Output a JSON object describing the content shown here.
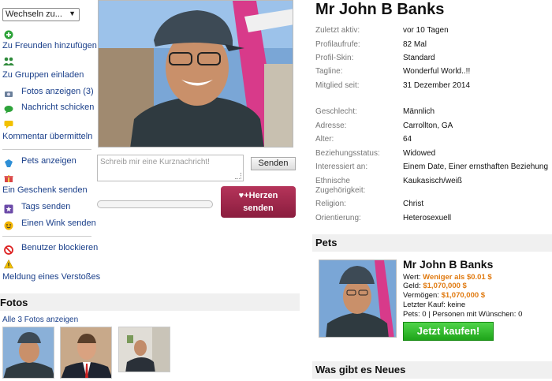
{
  "switcher": {
    "label": "Wechseln zu..."
  },
  "actions": {
    "add_friend": "Zu Freunden hinzufügen",
    "invite_groups": "Zu Gruppen einladen",
    "show_photos": "Fotos anzeigen (3)",
    "send_message": "Nachricht schicken",
    "send_comment": "Kommentar übermitteln",
    "show_pets": "Pets anzeigen",
    "send_gift": "Ein Geschenk senden",
    "send_tags": "Tags senden",
    "send_wink": "Einen Wink senden",
    "block_user": "Benutzer blockieren",
    "report": "Meldung eines Verstoßes"
  },
  "message": {
    "placeholder": "Schreib mir eine Kurznachricht!",
    "send_label": "Senden"
  },
  "hearts": {
    "label_line1": "Herzen",
    "label_line2": "senden",
    "progress": 0
  },
  "fotos": {
    "title": "Fotos",
    "all_link": "Alle 3 Fotos anzeigen"
  },
  "profile": {
    "name": "Mr John B Banks",
    "fields": [
      {
        "label": "Zuletzt aktiv:",
        "value": "vor 10 Tagen"
      },
      {
        "label": "Profilaufrufe:",
        "value": "82 Mal"
      },
      {
        "label": "Profil-Skin:",
        "value": "Standard"
      },
      {
        "label": "Tagline:",
        "value": "Wonderful World..!!"
      },
      {
        "label": "Mitglied seit:",
        "value": "31 Dezember 2014"
      },
      {
        "label": "Geschlecht:",
        "value": "Männlich"
      },
      {
        "label": "Adresse:",
        "value": "Carrollton, GA"
      },
      {
        "label": "Alter:",
        "value": "64"
      },
      {
        "label": "Beziehungsstatus:",
        "value": "Widowed"
      },
      {
        "label": "Interessiert an:",
        "value": "Einem Date, Einer ernsthaften Beziehung"
      },
      {
        "label": "Ethnische Zugehörigkeit:",
        "value": "Kaukasisch/weiß"
      },
      {
        "label": "Religion:",
        "value": "Christ"
      },
      {
        "label": "Orientierung:",
        "value": "Heterosexuell"
      }
    ]
  },
  "pets": {
    "title": "Pets",
    "name": "Mr John B Banks",
    "worth_label": "Wert:",
    "worth_value": "Weniger als $0.01 $",
    "money_label": "Geld:",
    "money_value": "$1,070,000 $",
    "assets_label": "Vermögen:",
    "assets_value": "$1,070,000 $",
    "last_buy": "Letzter Kauf: keine",
    "pets_wish": "Pets: 0 | Personen mit Wünschen: 0",
    "buy_label": "Jetzt kaufen!"
  },
  "news": {
    "title": "Was gibt es Neues"
  },
  "colors": {
    "link": "#1a3f8a",
    "accent": "#8a1d3e",
    "buy": "#1fa51a",
    "orange": "#e07a10"
  }
}
